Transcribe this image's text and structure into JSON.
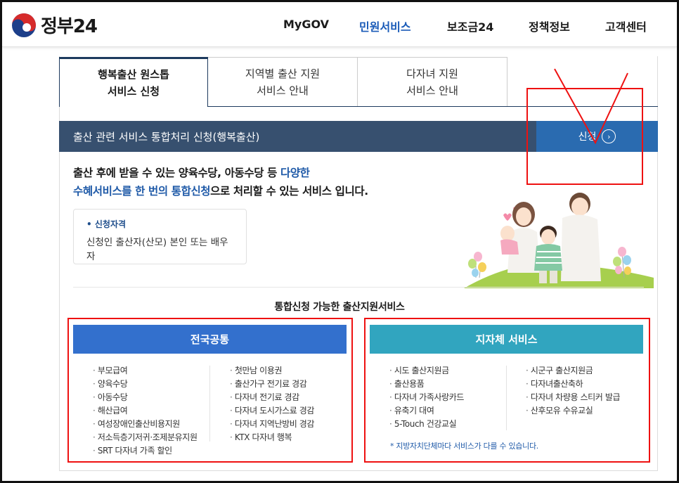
{
  "header": {
    "logo_text": "정부24",
    "nav": [
      "MyGOV",
      "민원서비스",
      "보조금24",
      "정책정보",
      "고객센터"
    ],
    "active_nav": "민원서비스"
  },
  "tabs": [
    {
      "line1": "행복출산 원스톱",
      "line2": "서비스 신청"
    },
    {
      "line1": "지역별 출산 지원",
      "line2": "서비스 안내"
    },
    {
      "line1": "다자녀 지원",
      "line2": "서비스 안내"
    }
  ],
  "service_bar": {
    "title": "출산 관련 서비스 통합처리 신청(행복출산)",
    "apply_label": "신청",
    "apply_icon": "chevron-right-icon"
  },
  "description": {
    "line1_a": "출산 후에 받을 수 있는 양육수당, 아동수당 등 ",
    "line1_hl": "다양한",
    "line2_hl": "수혜서비스를 한 번의 통합신청",
    "line2_b": "으로 처리할 수 있는 서비스 입니다."
  },
  "eligibility": {
    "label": "신청자격",
    "text": "신청인 출산자(산모) 본인 또는 배우자"
  },
  "section_title": "통합신청 가능한 출산지원서비스",
  "national": {
    "title": "전국공통",
    "left": [
      "부모급여",
      "양육수당",
      "아동수당",
      "해산급여",
      "여성장애인출산비용지원",
      "저소득층기저귀·조제분유지원",
      "SRT 다자녀 가족 할인"
    ],
    "right": [
      "첫만남 이용권",
      "출산가구 전기료 경감",
      "다자녀 전기료 경감",
      "다자녀 도시가스료 경감",
      "다자녀 지역난방비 경감",
      "KTX 다자녀 행복"
    ]
  },
  "local": {
    "title": "지자체 서비스",
    "left": [
      "시도 출산지원금",
      "출산용품",
      "다자녀 가족사랑카드",
      "유축기 대여",
      "5-Touch 건강교실"
    ],
    "right": [
      "시군구 출산지원금",
      "다자녀출산축하",
      "다자녀 차량용 스티커 발급",
      "산후모유 수유교실"
    ],
    "note": "* 지방자치단체마다 서비스가 다를 수 있습니다."
  },
  "colors": {
    "nav_active": "#1a5bb8",
    "service_bar": "#37506f",
    "apply_button": "#2a6bb0",
    "national_card": "#3370cd",
    "local_card": "#31a5bf",
    "annotation": "#ee1111"
  }
}
